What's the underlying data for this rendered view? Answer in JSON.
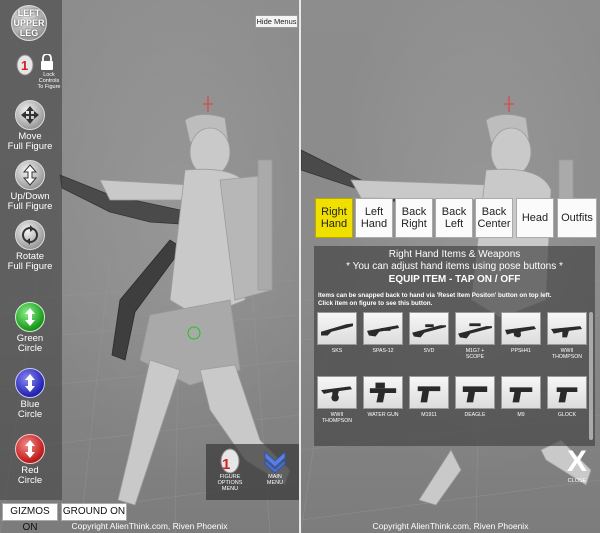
{
  "left_view": {
    "body_part": {
      "line1": "LEFT",
      "line2": "UPPER",
      "line3": "LEG"
    },
    "lock": {
      "label_l1": "Lock",
      "label_l2": "Controls",
      "label_l3": "To Figure"
    },
    "hide_menus_label": "Hide Menus",
    "tools": [
      {
        "l1": "Move",
        "l2": "Full Figure"
      },
      {
        "l1": "Up/Down",
        "l2": "Full Figure"
      },
      {
        "l1": "Rotate",
        "l2": "Full Figure"
      },
      {
        "l1": "Green",
        "l2": "Circle"
      },
      {
        "l1": "Blue",
        "l2": "Circle"
      },
      {
        "l1": "Red",
        "l2": "Circle"
      }
    ],
    "bottom_menu": {
      "figure_options": {
        "l1": "FIGURE",
        "l2": "OPTIONS",
        "l3": "MENU"
      },
      "main_menu": {
        "l1": "MAIN",
        "l2": "MENU"
      }
    },
    "gizmos_label": "GIZMOS ON",
    "ground_label": "GROUND ON",
    "copyright": "Copyright AlienThink.com, Riven Phoenix"
  },
  "right_view": {
    "tabs": [
      {
        "l1": "Right",
        "l2": "Hand",
        "active": true
      },
      {
        "l1": "Left",
        "l2": "Hand",
        "active": false
      },
      {
        "l1": "Back",
        "l2": "Right",
        "active": false
      },
      {
        "l1": "Back",
        "l2": "Left",
        "active": false
      },
      {
        "l1": "Back",
        "l2": "Center",
        "active": false
      },
      {
        "l1": "Head",
        "l2": "",
        "active": false
      },
      {
        "l1": "Outfits",
        "l2": "",
        "active": false
      }
    ],
    "panel": {
      "title": "Right Hand Items & Weapons",
      "subtitle": "* You can adjust hand items using pose buttons *",
      "equip": "EQUIP ITEM - TAP ON / OFF",
      "note_l1": "Items can be snapped back to hand via 'Reset Item Positon' button on top left.",
      "note_l2": "Click item on figure to see this button."
    },
    "weapons": [
      {
        "l1": "SKS",
        "l2": ""
      },
      {
        "l1": "SPAS-12",
        "l2": ""
      },
      {
        "l1": "SVD",
        "l2": ""
      },
      {
        "l1": "M1G7 +",
        "l2": "SCOPE"
      },
      {
        "l1": "PPSH41",
        "l2": ""
      },
      {
        "l1": "WWII",
        "l2": "THOMPSON"
      },
      {
        "l1": "WWII",
        "l2": "THOMPSON"
      },
      {
        "l1": "WATER GUN",
        "l2": ""
      },
      {
        "l1": "M1911",
        "l2": ""
      },
      {
        "l1": "DEAGLE",
        "l2": ""
      },
      {
        "l1": "M9",
        "l2": ""
      },
      {
        "l1": "GLOCK",
        "l2": ""
      }
    ],
    "close_glyph": "X",
    "close_label": "CLOSE",
    "copyright": "Copyright AlienThink.com, Riven Phoenix"
  },
  "colors": {
    "active_tab": "#f0e000",
    "panel_bg": "#464646",
    "viewport_bg": "#8a8a8a",
    "figure": "#cfcfcf"
  }
}
